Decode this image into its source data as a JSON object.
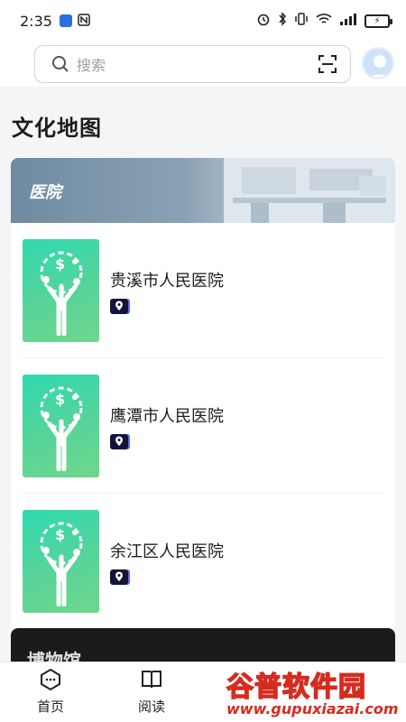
{
  "status_bar": {
    "time": "2:35",
    "battery": "⚡"
  },
  "search": {
    "placeholder": "搜索"
  },
  "page_title": "文化地图",
  "sections": [
    {
      "name": "医院",
      "items": [
        {
          "title": "贵溪市人民医院"
        },
        {
          "title": "鹰潭市人民医院"
        },
        {
          "title": "余江区人民医院"
        }
      ]
    },
    {
      "name": "博物馆"
    }
  ],
  "nav": {
    "items": [
      {
        "label": "首页"
      },
      {
        "label": "阅读"
      }
    ]
  },
  "watermark": {
    "title": "谷普软件园",
    "url": "www.gupuxiazai.com"
  },
  "colors": {
    "thumb_green": "#4fd8a0",
    "banner": "#7891a6",
    "badge": "#14143a"
  }
}
